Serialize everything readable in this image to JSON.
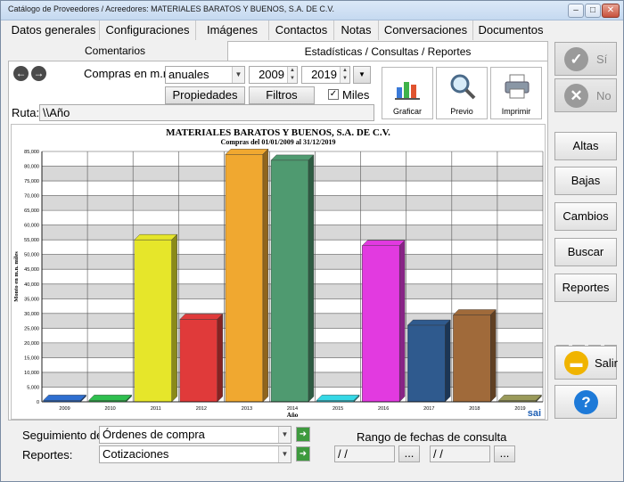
{
  "window": {
    "title": "Catálogo de Proveedores / Acreedores: MATERIALES BARATOS Y BUENOS, S.A. DE C.V."
  },
  "tabs": [
    {
      "label": "Datos generales"
    },
    {
      "label": "Configuraciones"
    },
    {
      "label": "Imágenes"
    },
    {
      "label": "Contactos"
    },
    {
      "label": "Notas"
    },
    {
      "label": "Conversaciones"
    },
    {
      "label": "Documentos"
    }
  ],
  "subtabs": [
    {
      "label": "Comentarios"
    },
    {
      "label": "Estadísticas / Consultas / Reportes"
    }
  ],
  "controls": {
    "compras_label": "Compras en m.n.:",
    "period_value": "anuales",
    "year_from": "2009",
    "year_to": "2019",
    "propiedades_label": "Propiedades",
    "filtros_label": "Filtros",
    "miles_label": "Miles",
    "miles_checked": "✓",
    "ruta_label": "Ruta:",
    "ruta_value": "\\\\Año"
  },
  "actions": [
    {
      "label": "Graficar",
      "icon": "bar-chart-icon"
    },
    {
      "label": "Previo",
      "icon": "magnifier-icon"
    },
    {
      "label": "Imprimir",
      "icon": "printer-icon"
    }
  ],
  "chart_data": {
    "type": "bar",
    "title": "MATERIALES BARATOS Y BUENOS, S.A. DE C.V.",
    "subtitle": "Compras del 01/01/2009 al 31/12/2019",
    "xlabel": "Año",
    "ylabel": "Monto en m.n. miles",
    "categories": [
      "2009",
      "2010",
      "2011",
      "2012",
      "2013",
      "2014",
      "2015",
      "2016",
      "2017",
      "2018",
      "2019"
    ],
    "values": [
      500,
      500,
      55000,
      28000,
      84000,
      82000,
      500,
      53000,
      26000,
      29500,
      500
    ],
    "colors": [
      "#2f6fd0",
      "#2fbf4f",
      "#e6e62a",
      "#e03a3a",
      "#f0a830",
      "#4f9a70",
      "#35d8e6",
      "#e23ae0",
      "#2f5a8e",
      "#a06a3a",
      "#9a9a5a"
    ],
    "ylim": [
      0,
      85000
    ],
    "yticks": [
      "0",
      "5,000",
      "10,000",
      "15,000",
      "20,000",
      "25,000",
      "30,000",
      "35,000",
      "40,000",
      "45,000",
      "50,000",
      "55,000",
      "60,000",
      "65,000",
      "70,000",
      "75,000",
      "80,000",
      "85,000"
    ],
    "grid": true,
    "watermark": "sai"
  },
  "bottom": {
    "seguimiento_label": "Seguimiento de:",
    "seguimiento_value": "Órdenes de compra",
    "reportes_label": "Reportes:",
    "reportes_value": "Cotizaciones",
    "rango_label": "Rango de fechas de consulta",
    "date_from": " / /",
    "date_to": " / /",
    "ellipsis": "..."
  },
  "sidebar": {
    "si_label": "Sí",
    "no_label": "No",
    "altas_label": "Altas",
    "bajas_label": "Bajas",
    "cambios_label": "Cambios",
    "buscar_label": "Buscar",
    "reportes_label": "Reportes",
    "salir_label": "Salir"
  }
}
